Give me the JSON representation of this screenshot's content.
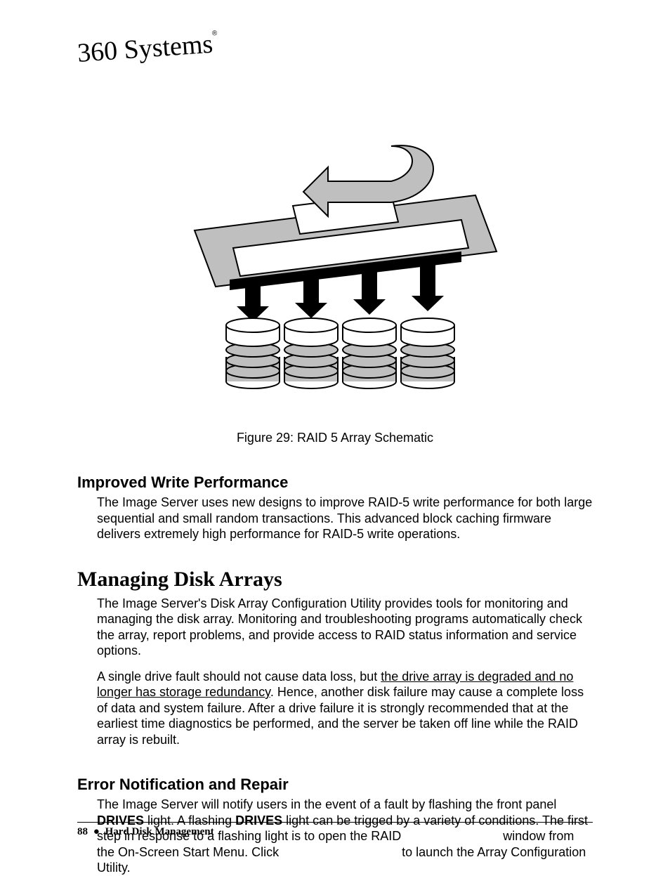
{
  "logo_text": "360 Systems",
  "figure": {
    "caption": "Figure 29: RAID 5 Array Schematic"
  },
  "subheading1": "Improved Write Performance",
  "p1": "The Image Server uses new designs to improve RAID-5 write performance for both large sequential and small random transactions.  This advanced block caching firmware delivers extremely high performance for RAID-5 write operations.",
  "heading": "Managing Disk Arrays",
  "p2": "The Image Server's Disk Array Configuration Utility provides tools for monitoring and managing the disk array.  Monitoring and troubleshooting programs automatically check the array, report problems, and provide access to RAID status information and service options.",
  "p3a": "A single drive fault should not cause data loss, but ",
  "p3u": "the drive array is degraded and no longer has storage redundancy",
  "p3b": ".  Hence, another disk failure may cause a complete loss of data and system failure.  After a drive failure it is strongly recommended that at the earliest time diagnostics be performed, and the server be taken off line while the RAID array is rebuilt.",
  "subheading2": "Error Notification and Repair",
  "p4a": "The Image Server will notify users in the event of a fault by flashing the front panel ",
  "p4drives1": "DRIVES",
  "p4b": " light.  A flashing ",
  "p4drives2": "DRIVES",
  "p4c": " light can be trigged by a variety of conditions.  The first step in response to a flashing light is to open the RAID ",
  "p4gap1": "                           ",
  "p4d": " window from the On-Screen Start Menu.  Click ",
  "p4gap2": "                                 ",
  "p4e": " to launch the Array Configuration Utility.",
  "footer": {
    "pagenum": "88",
    "bullet": "●",
    "section": "Hard Disk Management"
  }
}
